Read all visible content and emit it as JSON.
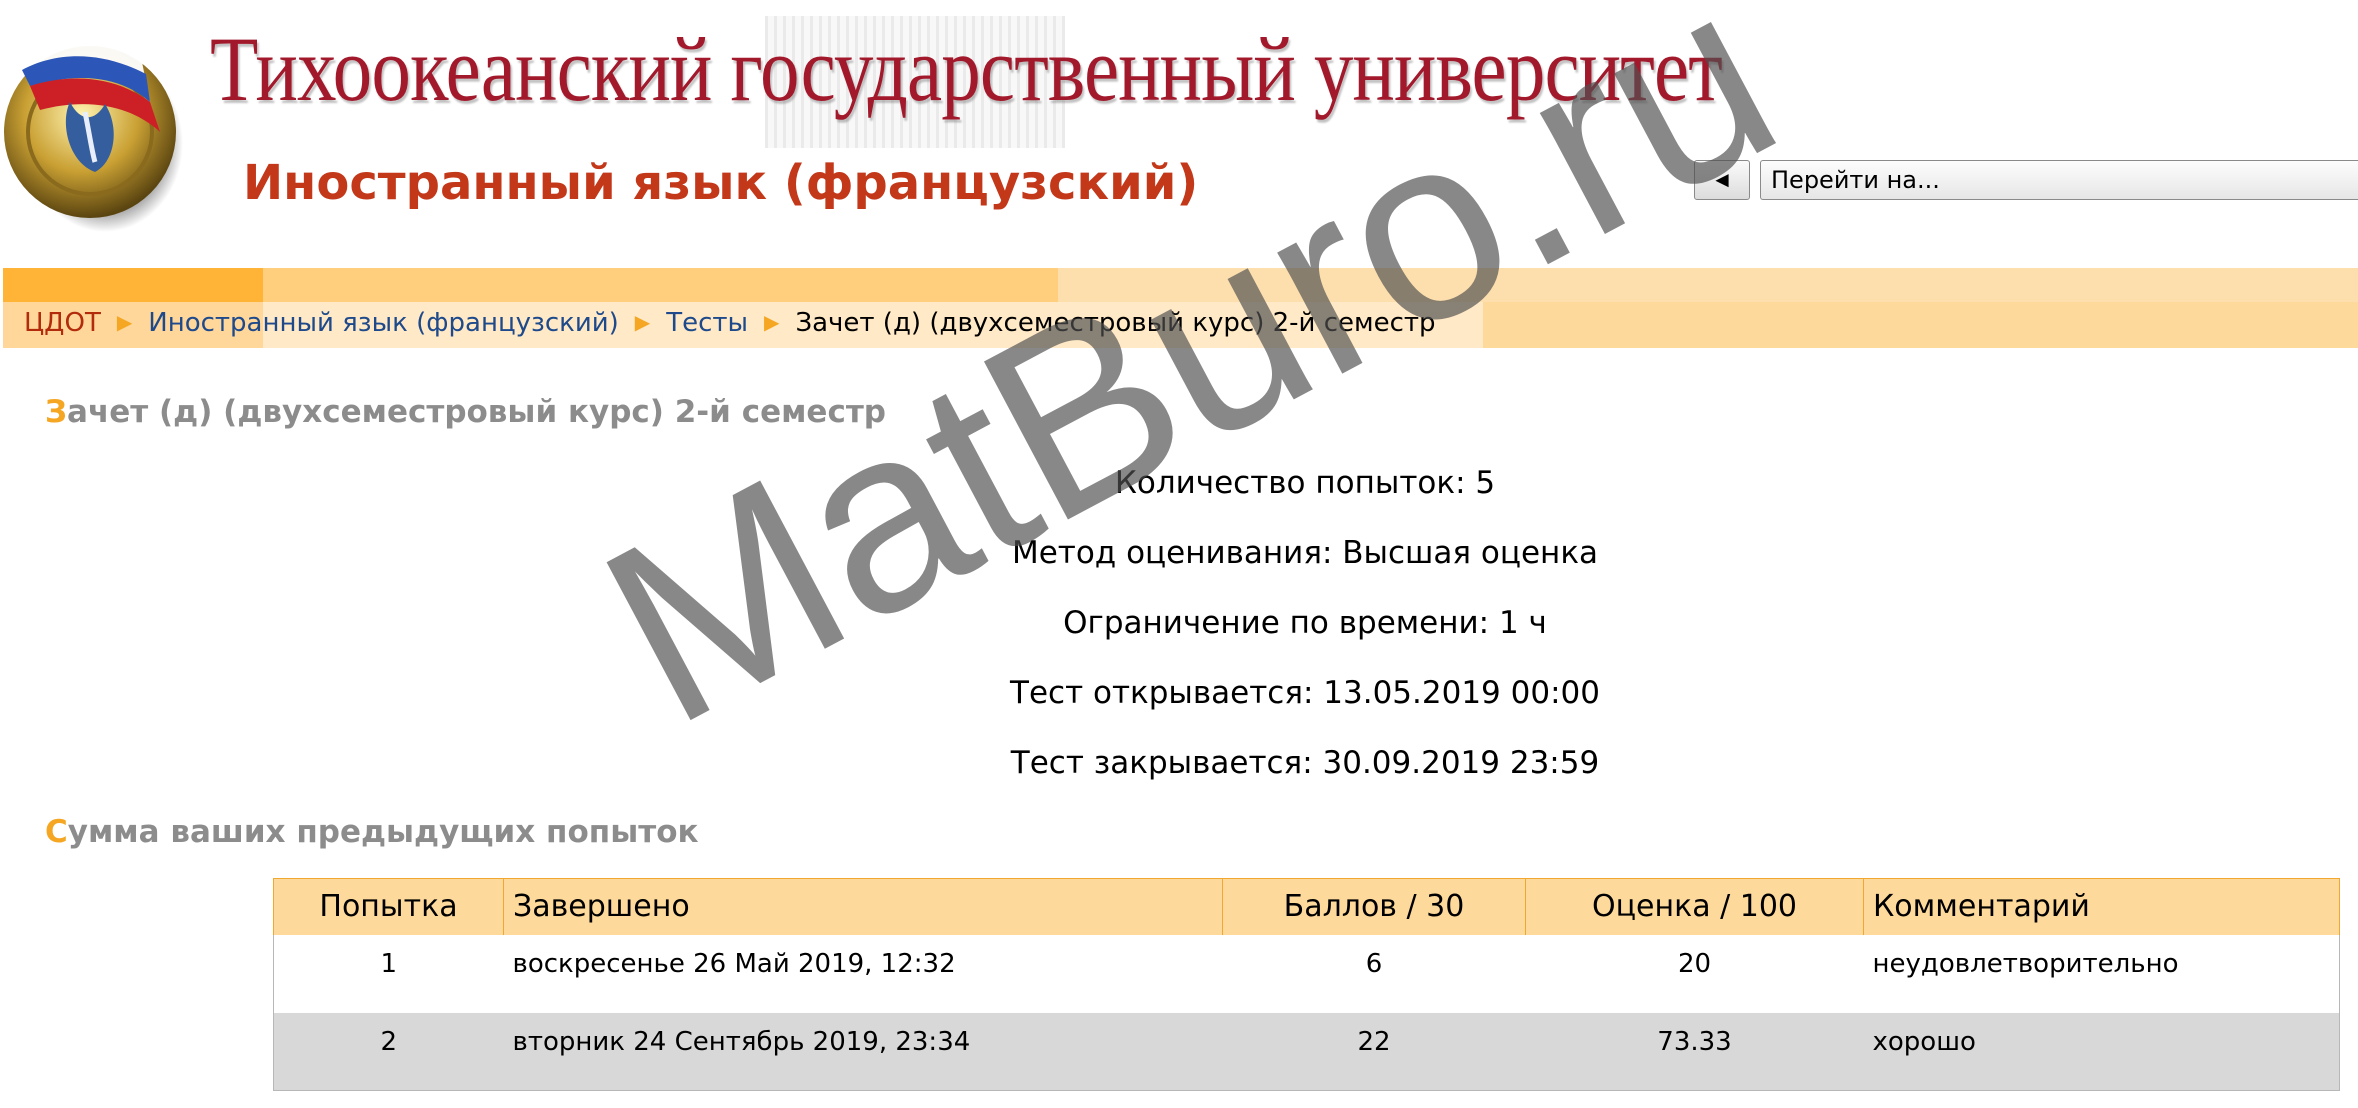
{
  "header": {
    "university_title": "Тихоокеанский государственный университет",
    "course_title": "Иностранный язык (французский)",
    "logo_icon": "university-emblem-icon",
    "nav_back_label": "◄",
    "nav_jump_label": "Перейти на..."
  },
  "breadcrumb": {
    "home": "ЦДОТ",
    "course": "Иностранный язык (французский)",
    "tests": "Тесты",
    "current": "Зачет (д) (двухсеместровый курс) 2-й семестр",
    "separator": "▶"
  },
  "quiz": {
    "heading_first": "З",
    "heading_rest": "ачет (д) (двухсеместровый курс) 2-й семестр",
    "attempts": "Количество попыток: 5",
    "grading_method": "Метод оценивания: Высшая оценка",
    "time_limit": "Ограничение по времени: 1 ч",
    "opens": "Тест открывается: 13.05.2019 00:00",
    "closes": "Тест закрывается: 30.09.2019 23:59"
  },
  "summary": {
    "heading_first": "С",
    "heading_rest": "умма ваших предыдущих попыток",
    "columns": [
      "Попытка",
      "Завершено",
      "Баллов / 30",
      "Оценка / 100",
      "Комментарий"
    ],
    "rows": [
      {
        "attempt": "1",
        "completed": "воскресенье 26 Май 2019, 12:32",
        "score": "6",
        "grade": "20",
        "comment": "неудовлетворительно"
      },
      {
        "attempt": "2",
        "completed": "вторник 24 Сентябрь 2019, 23:34",
        "score": "22",
        "grade": "73.33",
        "comment": "хорошо"
      }
    ]
  },
  "watermark": "MatBuro.ru",
  "colors": {
    "title_red": "#a3192c",
    "course_orange": "#c4381a",
    "navbar": "#fdd99b",
    "accent": "#f5a623",
    "heading_gray": "#8c8c8c",
    "row_alt": "#d8d8d8"
  }
}
